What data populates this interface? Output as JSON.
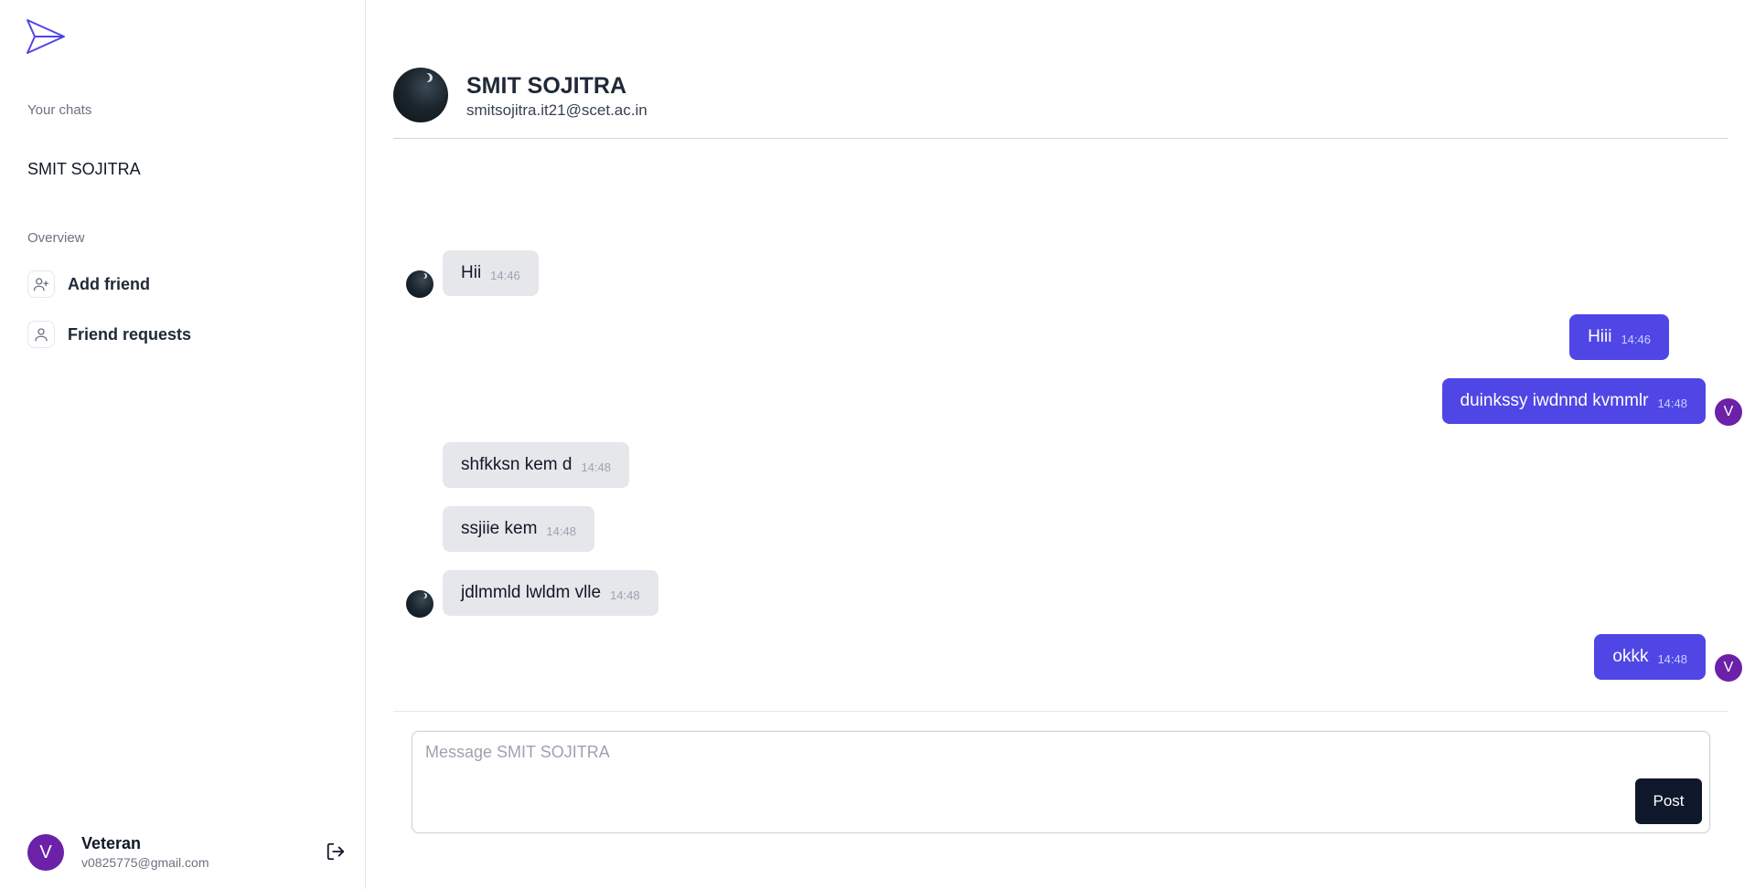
{
  "sidebar": {
    "logo_icon": "paper-plane-icon",
    "your_chats_label": "Your chats",
    "chats": [
      {
        "name": "SMIT SOJITRA"
      }
    ],
    "overview_label": "Overview",
    "nav": [
      {
        "label": "Add friend",
        "icon": "user-plus-icon"
      },
      {
        "label": "Friend requests",
        "icon": "user-icon"
      }
    ],
    "profile": {
      "initial": "V",
      "name": "Veteran",
      "email": "v0825775@gmail.com",
      "avatar_color": "#6b21a8"
    },
    "logout_icon": "logout-icon"
  },
  "chat": {
    "partner": {
      "name": "SMIT SOJITRA",
      "email": "smitsojitra.it21@scet.ac.in"
    },
    "messages": [
      {
        "direction": "in",
        "text": "Hii",
        "time": "14:46",
        "show_avatar": true
      },
      {
        "direction": "out",
        "text": "Hiii",
        "time": "14:46",
        "show_avatar": false
      },
      {
        "direction": "out",
        "text": "duinkssy iwdnnd kvmmlr",
        "time": "14:48",
        "show_avatar": true
      },
      {
        "direction": "in",
        "text": "shfkksn kem d",
        "time": "14:48",
        "show_avatar": false
      },
      {
        "direction": "in",
        "text": "ssjiie kem",
        "time": "14:48",
        "show_avatar": false
      },
      {
        "direction": "in",
        "text": "jdlmmld lwldm vlle",
        "time": "14:48",
        "show_avatar": true
      },
      {
        "direction": "out",
        "text": "okkk",
        "time": "14:48",
        "show_avatar": true
      }
    ],
    "self_initial": "V",
    "composer": {
      "placeholder": "Message SMIT SOJITRA",
      "value": "",
      "post_label": "Post"
    }
  },
  "colors": {
    "accent": "#4f46e5",
    "incoming_bubble": "#e5e7eb",
    "post_button": "#0f172a",
    "self_avatar": "#6b21a8"
  }
}
